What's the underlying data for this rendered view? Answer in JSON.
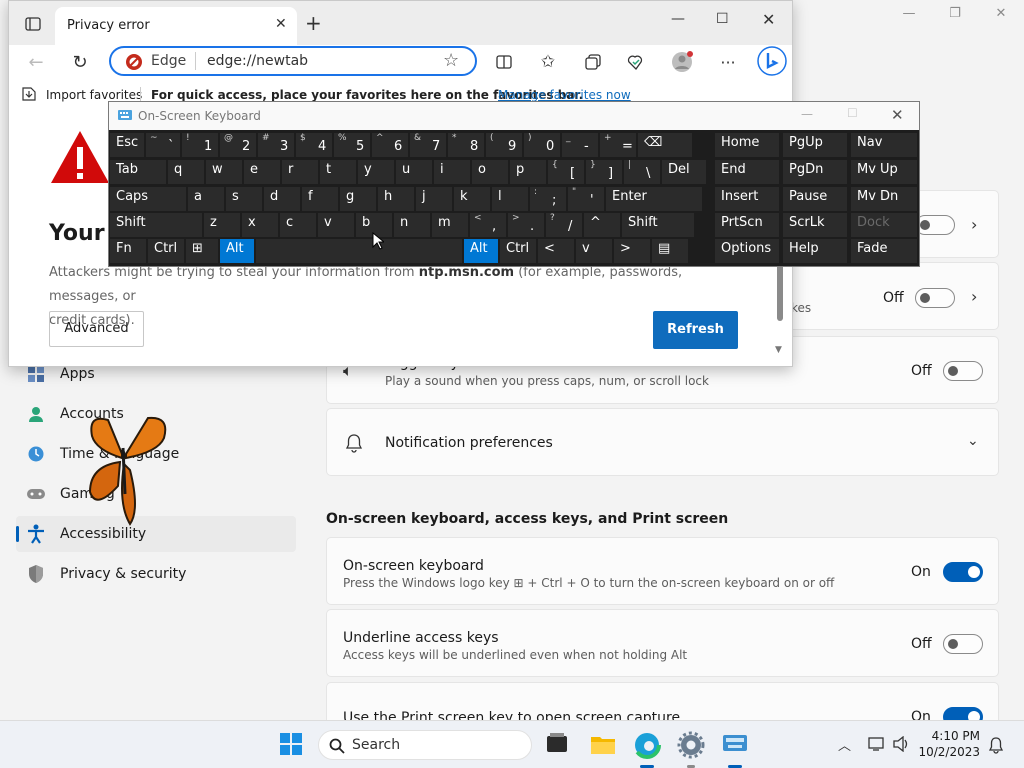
{
  "settings": {
    "nav": {
      "apps": "Apps",
      "accounts": "Accounts",
      "time_language": "Time & language",
      "gaming": "Gaming",
      "accessibility": "Accessibility",
      "privacy": "Privacy & security"
    },
    "row_off_1": "Off",
    "row_hint": "kes",
    "toggle_keys": {
      "title": "Toggle keys",
      "desc": "Play a sound when you press caps, num, or scroll lock",
      "state": "Off"
    },
    "notification_prefs": "Notification preferences",
    "section_title": "On-screen keyboard, access keys, and Print screen",
    "osk_setting": {
      "title": "On-screen keyboard",
      "desc": "Press the Windows logo key ⊞ + Ctrl + O to turn the on-screen keyboard on or off",
      "state": "On"
    },
    "underline": {
      "title": "Underline access keys",
      "desc": "Access keys will be underlined even when not holding Alt",
      "state": "Off"
    },
    "printscreen": {
      "title": "Use the Print screen key to open screen capture",
      "state": "On"
    }
  },
  "edge": {
    "tab_title": "Privacy error",
    "address_label": "Edge",
    "address_url": "edge://newtab",
    "import_favorites": "Import favorites",
    "fav_hint": "For quick access, place your favorites here on the favorites bar.",
    "manage_favorites": "Manage favorites now",
    "heading": "Your c",
    "body_line1_a": "Attackers might be trying to steal your information from ",
    "body_host": "ntp.msn.com",
    "body_line1_b": " (for example, passwords, messages, or",
    "body_line2": "credit cards).",
    "advanced": "Advanced",
    "refresh": "Refresh"
  },
  "osk": {
    "title": "On-Screen Keyboard",
    "row1": [
      [
        "",
        "Esc"
      ],
      [
        "~",
        "`"
      ],
      [
        "!",
        "1"
      ],
      [
        "@",
        "2"
      ],
      [
        "#",
        "3"
      ],
      [
        "$",
        "4"
      ],
      [
        "%",
        "5"
      ],
      [
        "^",
        "6"
      ],
      [
        "&",
        "7"
      ],
      [
        "*",
        "8"
      ],
      [
        "(",
        "9"
      ],
      [
        ")",
        "0"
      ],
      [
        "_",
        "-"
      ],
      [
        "+",
        "="
      ],
      [
        "",
        "⌫"
      ]
    ],
    "row2": [
      [
        "",
        "Tab"
      ],
      [
        "",
        "q"
      ],
      [
        "",
        "w"
      ],
      [
        "",
        "e"
      ],
      [
        "",
        "r"
      ],
      [
        "",
        "t"
      ],
      [
        "",
        "y"
      ],
      [
        "",
        "u"
      ],
      [
        "",
        "i"
      ],
      [
        "",
        "o"
      ],
      [
        "",
        "p"
      ],
      [
        "{",
        "["
      ],
      [
        "}",
        "]"
      ],
      [
        "|",
        "\\"
      ],
      [
        "",
        "Del"
      ]
    ],
    "row3": [
      [
        "",
        "Caps"
      ],
      [
        "",
        "a"
      ],
      [
        "",
        "s"
      ],
      [
        "",
        "d"
      ],
      [
        "",
        "f"
      ],
      [
        "",
        "g"
      ],
      [
        "",
        "h"
      ],
      [
        "",
        "j"
      ],
      [
        "",
        "k"
      ],
      [
        "",
        "l"
      ],
      [
        ":",
        ";"
      ],
      [
        "\"",
        "'"
      ],
      [
        "",
        "Enter"
      ]
    ],
    "row4": [
      [
        "",
        "Shift"
      ],
      [
        "",
        "z"
      ],
      [
        "",
        "x"
      ],
      [
        "",
        "c"
      ],
      [
        "",
        "v"
      ],
      [
        "",
        "b"
      ],
      [
        "",
        "n"
      ],
      [
        "",
        "m"
      ],
      [
        "<",
        ","
      ],
      [
        ">",
        "."
      ],
      [
        "?",
        "/"
      ],
      [
        "",
        "^"
      ],
      [
        "",
        "Shift"
      ]
    ],
    "row5": [
      [
        "",
        "Fn"
      ],
      [
        "",
        "Ctrl"
      ],
      [
        "",
        "⊞"
      ],
      [
        "",
        "Alt"
      ],
      [
        "",
        ""
      ],
      [
        "",
        "Alt"
      ],
      [
        "",
        "Ctrl"
      ],
      [
        "",
        "<"
      ],
      [
        "",
        "v"
      ],
      [
        "",
        ">"
      ],
      [
        "",
        "▤"
      ]
    ],
    "nav": [
      [
        "Home",
        "PgUp",
        "Nav"
      ],
      [
        "End",
        "PgDn",
        "Mv Up"
      ],
      [
        "Insert",
        "Pause",
        "Mv Dn"
      ],
      [
        "PrtScn",
        "ScrLk",
        "Dock"
      ],
      [
        "Options",
        "Help",
        "Fade"
      ]
    ]
  },
  "taskbar": {
    "search": "Search",
    "time": "4:10 PM",
    "date": "10/2/2023"
  }
}
